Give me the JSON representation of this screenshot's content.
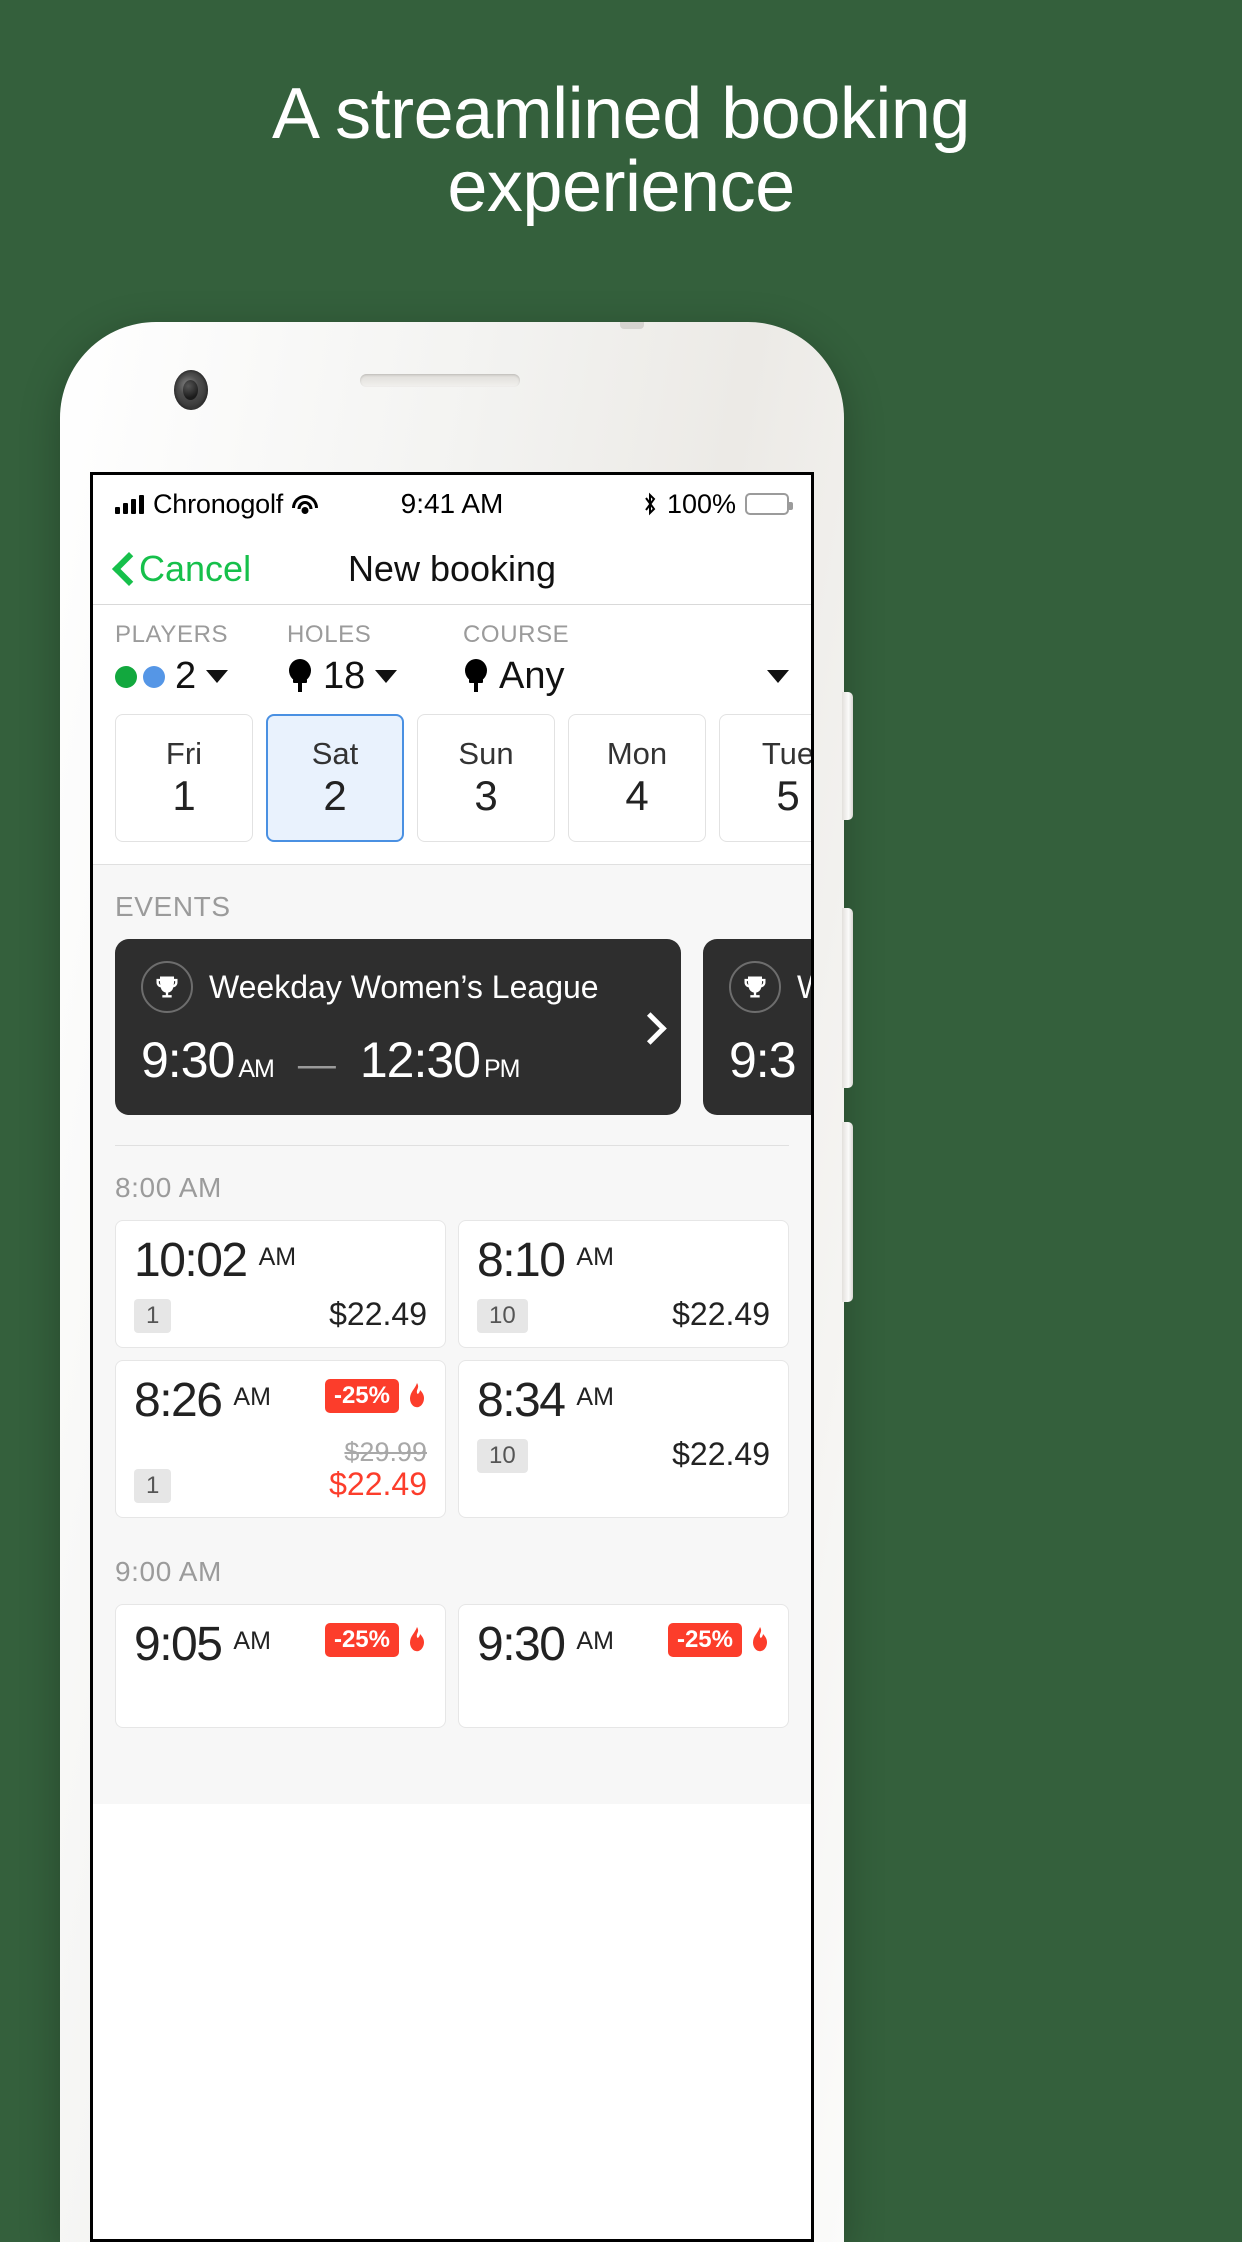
{
  "headline": "A streamlined booking\nexperience",
  "theme": {
    "background": "#34603c",
    "accent_green": "#16c04b",
    "accent_blue": "#4a90e2",
    "sale_red": "#fc3d2b"
  },
  "statusbar": {
    "carrier": "Chronogolf",
    "signal_icon": "signal-bars-icon",
    "wifi_icon": "wifi-icon",
    "time": "9:41 AM",
    "bluetooth_icon": "bluetooth-icon",
    "battery_pct": "100%",
    "battery_icon": "battery-full-icon"
  },
  "navbar": {
    "back_icon": "chevron-left-icon",
    "cancel_label": "Cancel",
    "title": "New booking"
  },
  "filters": [
    {
      "id": "players",
      "label": "PLAYERS",
      "value": "2",
      "icon": "player-dots-icon",
      "caret": "caret-down-icon"
    },
    {
      "id": "holes",
      "label": "HOLES",
      "value": "18",
      "icon": "golf-tee-icon",
      "caret": "caret-down-icon"
    },
    {
      "id": "course",
      "label": "COURSE",
      "value": "Any",
      "icon": "golf-tee-icon",
      "caret": "caret-down-icon"
    }
  ],
  "dates": [
    {
      "dow": "Fri",
      "day": "1",
      "selected": false
    },
    {
      "dow": "Sat",
      "day": "2",
      "selected": true
    },
    {
      "dow": "Sun",
      "day": "3",
      "selected": false
    },
    {
      "dow": "Mon",
      "day": "4",
      "selected": false
    },
    {
      "dow": "Tue",
      "day": "5",
      "selected": false
    }
  ],
  "events": {
    "label": "EVENTS",
    "cards": [
      {
        "icon": "trophy-icon",
        "title": "Weekday Women’s League",
        "start_time": "9:30",
        "start_meridiem": "AM",
        "dash": "—",
        "end_time": "12:30",
        "end_meridiem": "PM",
        "chevron": "chevron-right-icon"
      },
      {
        "icon": "trophy-icon",
        "title": "W",
        "start_time": "9:3",
        "start_meridiem": "",
        "dash": "",
        "end_time": "",
        "end_meridiem": "",
        "chevron": ""
      }
    ]
  },
  "tee_time_groups": [
    {
      "header": "8:00 AM",
      "rows": [
        [
          {
            "time": "10:02",
            "meridiem": "AM",
            "qty": "1",
            "price": "$22.49",
            "old_price": "",
            "discount": "",
            "hot": false
          },
          {
            "time": "8:10",
            "meridiem": "AM",
            "qty": "10",
            "price": "$22.49",
            "old_price": "",
            "discount": "",
            "hot": false
          }
        ],
        [
          {
            "time": "8:26",
            "meridiem": "AM",
            "qty": "1",
            "price": "$22.49",
            "old_price": "$29.99",
            "discount": "-25%",
            "hot": true
          },
          {
            "time": "8:34",
            "meridiem": "AM",
            "qty": "10",
            "price": "$22.49",
            "old_price": "",
            "discount": "",
            "hot": false
          }
        ]
      ]
    },
    {
      "header": "9:00 AM",
      "rows": [
        [
          {
            "time": "9:05",
            "meridiem": "AM",
            "qty": "",
            "price": "",
            "old_price": "",
            "discount": "-25%",
            "hot": true
          },
          {
            "time": "9:30",
            "meridiem": "AM",
            "qty": "",
            "price": "",
            "old_price": "",
            "discount": "-25%",
            "hot": true
          }
        ]
      ]
    }
  ]
}
